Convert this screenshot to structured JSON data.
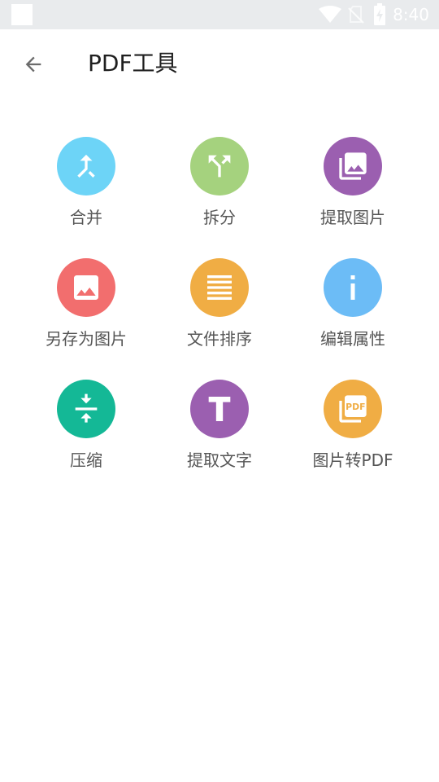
{
  "status_bar": {
    "time": "8:40",
    "icons": [
      "notification-square-icon",
      "wifi-icon",
      "no-sim-icon",
      "battery-charging-icon"
    ]
  },
  "app_bar": {
    "back_icon": "arrow-back-icon",
    "title": "PDF工具"
  },
  "colors": {
    "merge": "#6dd4f7",
    "split": "#a5d27e",
    "extract_images": "#9b5fb0",
    "save_as_images": "#f26e6e",
    "sort_pages": "#f0ad44",
    "edit_properties": "#6cbcf6",
    "compress": "#14b896",
    "extract_text": "#9b5fb0",
    "images_to_pdf": "#f0ad44"
  },
  "tools": [
    {
      "label": "合并",
      "icon": "merge-icon"
    },
    {
      "label": "拆分",
      "icon": "split-icon"
    },
    {
      "label": "提取图片",
      "icon": "photo-library-icon"
    },
    {
      "label": "另存为图片",
      "icon": "image-icon"
    },
    {
      "label": "文件排序",
      "icon": "list-lines-icon"
    },
    {
      "label": "编辑属性",
      "icon": "info-icon"
    },
    {
      "label": "压缩",
      "icon": "compress-icon"
    },
    {
      "label": "提取文字",
      "icon": "text-t-icon"
    },
    {
      "label": "图片转PDF",
      "icon": "pdf-stack-icon"
    }
  ]
}
